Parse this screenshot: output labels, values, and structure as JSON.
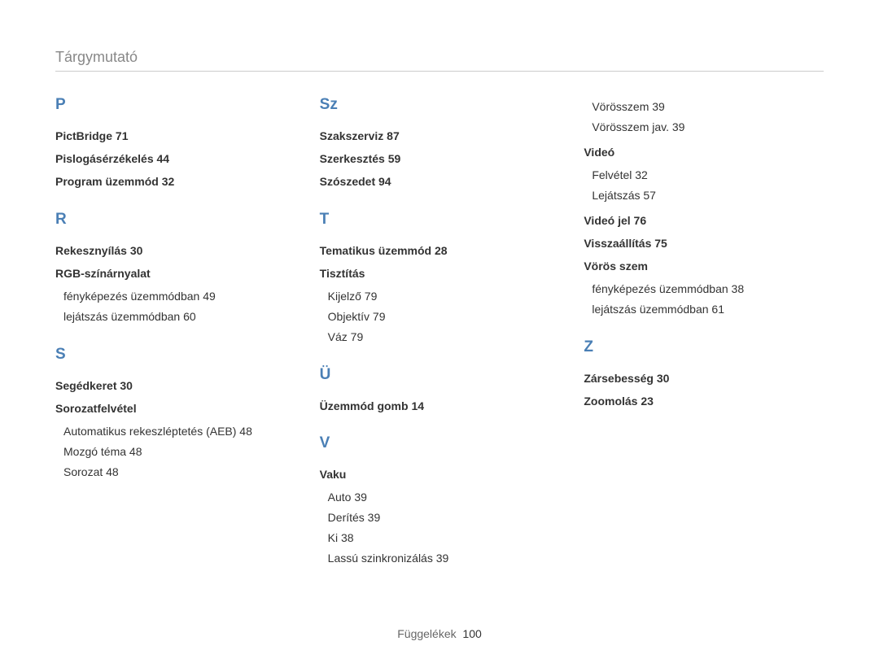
{
  "title": "Tárgymutató",
  "footer": {
    "label": "Függelékek",
    "page": "100"
  },
  "col1": {
    "L1": "P",
    "p1": "PictBridge  71",
    "p2": "Pislogásérzékelés  44",
    "p3": "Program üzemmód  32",
    "L2": "R",
    "r1": "Rekesznyílás  30",
    "r2": "RGB-színárnyalat",
    "r2a": "fényképezés üzemmódban  49",
    "r2b": "lejátszás üzemmódban  60",
    "L3": "S",
    "s1": "Segédkeret  30",
    "s2": "Sorozatfelvétel",
    "s2a": "Automatikus rekeszléptetés (AEB)  48",
    "s2b": "Mozgó téma  48",
    "s2c": "Sorozat  48"
  },
  "col2": {
    "L1": "Sz",
    "sz1": "Szakszerviz  87",
    "sz2": "Szerkesztés  59",
    "sz3": "Szószedet  94",
    "L2": "T",
    "t1": "Tematikus üzemmód  28",
    "t2": "Tisztítás",
    "t2a": "Kijelző  79",
    "t2b": "Objektív  79",
    "t2c": "Váz  79",
    "L3": "Ü",
    "u1": "Üzemmód gomb  14",
    "L4": "V",
    "v1": "Vaku",
    "v1a": "Auto  39",
    "v1b": "Derítés  39",
    "v1c": "Ki  38",
    "v1d": "Lassú szinkronizálás  39"
  },
  "col3": {
    "v1e": "Vörösszem  39",
    "v1f": "Vörösszem jav.  39",
    "v2": "Videó",
    "v2a": "Felvétel  32",
    "v2b": "Lejátszás  57",
    "v3": "Videó jel  76",
    "v4": "Visszaállítás  75",
    "v5": "Vörös szem",
    "v5a": "fényképezés üzemmódban  38",
    "v5b": "lejátszás üzemmódban  61",
    "L1": "Z",
    "z1": "Zársebesség  30",
    "z2": "Zoomolás  23"
  }
}
